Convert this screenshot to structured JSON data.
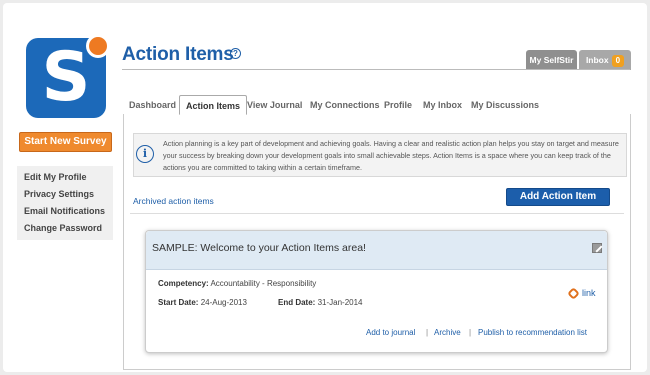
{
  "brand": {
    "logo_letter": "S",
    "accent": "#1c69b9",
    "dot": "#ee7a22"
  },
  "sidebar": {
    "start_button": "Start New Survey",
    "items": [
      {
        "label": "Edit My Profile"
      },
      {
        "label": "Privacy Settings"
      },
      {
        "label": "Email Notifications"
      },
      {
        "label": "Change Password"
      }
    ]
  },
  "header": {
    "title": "Action Items",
    "help_icon": "?",
    "my_selfstir": "My SelfStir",
    "inbox_label": "Inbox",
    "inbox_count": "0"
  },
  "tabs": [
    {
      "label": "Dashboard"
    },
    {
      "label": "Action Items",
      "active": true
    },
    {
      "label": "View Journal"
    },
    {
      "label": "My Connections"
    },
    {
      "label": "Profile"
    },
    {
      "label": "My Inbox"
    },
    {
      "label": "My Discussions"
    }
  ],
  "info": {
    "icon": "i",
    "text": "Action planning is a key part of development and achieving goals. Having a clear and realistic action plan helps you stay on target and measure your success by breaking down your development goals into small achievable steps. Action Items is a space where you can keep track of the actions you are committed to taking within a certain timeframe."
  },
  "archived_link": "Archived action items",
  "add_button": "Add Action Item",
  "card": {
    "title": "SAMPLE: Welcome to your Action Items area!",
    "competency_label": "Competency:",
    "competency_value": "Accountability - Responsibility",
    "start_label": "Start Date:",
    "start_value": "24-Aug-2013",
    "end_label": "End Date:",
    "end_value": "31-Jan-2014",
    "link_label": "link",
    "actions": [
      "Add to journal",
      "Archive",
      "Publish to recommendation list"
    ],
    "separator": "|"
  }
}
